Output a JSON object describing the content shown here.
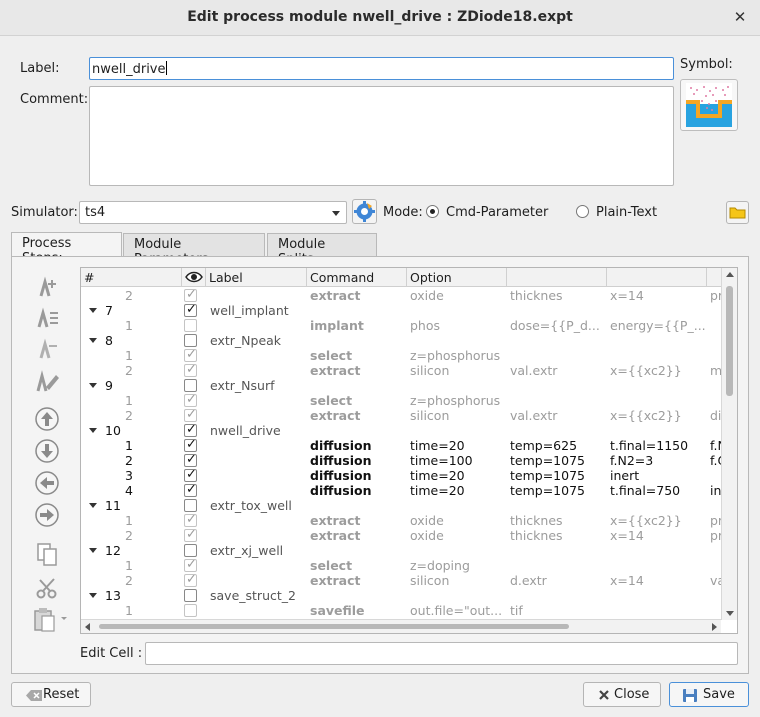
{
  "window": {
    "title": "Edit process module nwell_drive : ZDiode18.expt"
  },
  "form": {
    "label_caption": "Label:",
    "label_value": "nwell_drive",
    "comment_caption": "Comment:",
    "comment_value": "",
    "symbol_caption": "Symbol:",
    "simulator_caption": "Simulator:",
    "simulator_value": "ts4",
    "mode_caption": "Mode:",
    "mode_options": [
      "Cmd-Parameter",
      "Plain-Text"
    ],
    "mode_selected": "Cmd-Parameter"
  },
  "tabs": [
    "Process Steps:",
    "Module Parameters:",
    "Module Splits:"
  ],
  "grid": {
    "headers": [
      "#",
      "",
      "Label",
      "Command",
      "Option",
      "",
      "",
      ""
    ],
    "rows": [
      {
        "kind": "sub",
        "n": "2",
        "checked": true,
        "dim": true,
        "cmd": "extract",
        "o1": "oxide",
        "o2": "thicknes",
        "o3": "x=14",
        "o4": "pr"
      },
      {
        "kind": "grp",
        "n": "7",
        "checked": true,
        "label": "well_implant"
      },
      {
        "kind": "sub",
        "n": "1",
        "checked": false,
        "dim": true,
        "cmd": "implant",
        "o1": "phos",
        "o2": "dose={{P_d...",
        "o3": "energy={{P_...",
        "o4": ""
      },
      {
        "kind": "grp",
        "n": "8",
        "checked": false,
        "label": "extr_Npeak"
      },
      {
        "kind": "sub",
        "n": "1",
        "checked": true,
        "dim": true,
        "cmd": "select",
        "o1": "z=phosphorus",
        "o2": "",
        "o3": "",
        "o4": ""
      },
      {
        "kind": "sub",
        "n": "2",
        "checked": true,
        "dim": true,
        "cmd": "extract",
        "o1": "silicon",
        "o2": "val.extr",
        "o3": "x={{xc2}}",
        "o4": "ma"
      },
      {
        "kind": "grp",
        "n": "9",
        "checked": false,
        "label": "extr_Nsurf"
      },
      {
        "kind": "sub",
        "n": "1",
        "checked": true,
        "dim": true,
        "cmd": "select",
        "o1": "z=phosphorus",
        "o2": "",
        "o3": "",
        "o4": ""
      },
      {
        "kind": "sub",
        "n": "2",
        "checked": true,
        "dim": true,
        "cmd": "extract",
        "o1": "silicon",
        "o2": "val.extr",
        "o3": "x={{xc2}}",
        "o4": "dis"
      },
      {
        "kind": "grp",
        "n": "10",
        "checked": true,
        "label": "nwell_drive"
      },
      {
        "kind": "sub",
        "n": "1",
        "checked": true,
        "dim": false,
        "cmd": "diffusion",
        "o1": "time=20",
        "o2": "temp=625",
        "o3": "t.final=1150",
        "o4": "f.N"
      },
      {
        "kind": "sub",
        "n": "2",
        "checked": true,
        "dim": false,
        "cmd": "diffusion",
        "o1": "time=100",
        "o2": "temp=1075",
        "o3": "f.N2=3",
        "o4": "f.O"
      },
      {
        "kind": "sub",
        "n": "3",
        "checked": true,
        "dim": false,
        "cmd": "diffusion",
        "o1": "time=20",
        "o2": "temp=1075",
        "o3": "inert",
        "o4": ""
      },
      {
        "kind": "sub",
        "n": "4",
        "checked": true,
        "dim": false,
        "cmd": "diffusion",
        "o1": "time=20",
        "o2": "temp=1075",
        "o3": "t.final=750",
        "o4": "ine"
      },
      {
        "kind": "grp",
        "n": "11",
        "checked": false,
        "label": "extr_tox_well"
      },
      {
        "kind": "sub",
        "n": "1",
        "checked": true,
        "dim": true,
        "cmd": "extract",
        "o1": "oxide",
        "o2": "thicknes",
        "o3": "x={{xc2}}",
        "o4": "pr"
      },
      {
        "kind": "sub",
        "n": "2",
        "checked": true,
        "dim": true,
        "cmd": "extract",
        "o1": "oxide",
        "o2": "thicknes",
        "o3": "x=14",
        "o4": "pr"
      },
      {
        "kind": "grp",
        "n": "12",
        "checked": false,
        "label": "extr_xj_well"
      },
      {
        "kind": "sub",
        "n": "1",
        "checked": true,
        "dim": true,
        "cmd": "select",
        "o1": "z=doping",
        "o2": "",
        "o3": "",
        "o4": ""
      },
      {
        "kind": "sub",
        "n": "2",
        "checked": true,
        "dim": true,
        "cmd": "extract",
        "o1": "silicon",
        "o2": "d.extr",
        "o3": "x=14",
        "o4": "va"
      },
      {
        "kind": "grp",
        "n": "13",
        "checked": false,
        "label": "save_struct_2"
      },
      {
        "kind": "sub",
        "n": "1",
        "checked": false,
        "dim": true,
        "cmd": "savefile",
        "o1": "out.file=\"out...",
        "o2": "tif",
        "o3": "",
        "o4": ""
      }
    ]
  },
  "edit_cell": {
    "caption": "Edit Cell :",
    "value": ""
  },
  "buttons": {
    "reset": "Reset",
    "close": "Close",
    "save": "Save"
  },
  "colors": {
    "accent": "#4a90d9",
    "folder": "#f5c518",
    "symbol_orange": "#f5a623",
    "symbol_blue": "#29a3e0"
  }
}
